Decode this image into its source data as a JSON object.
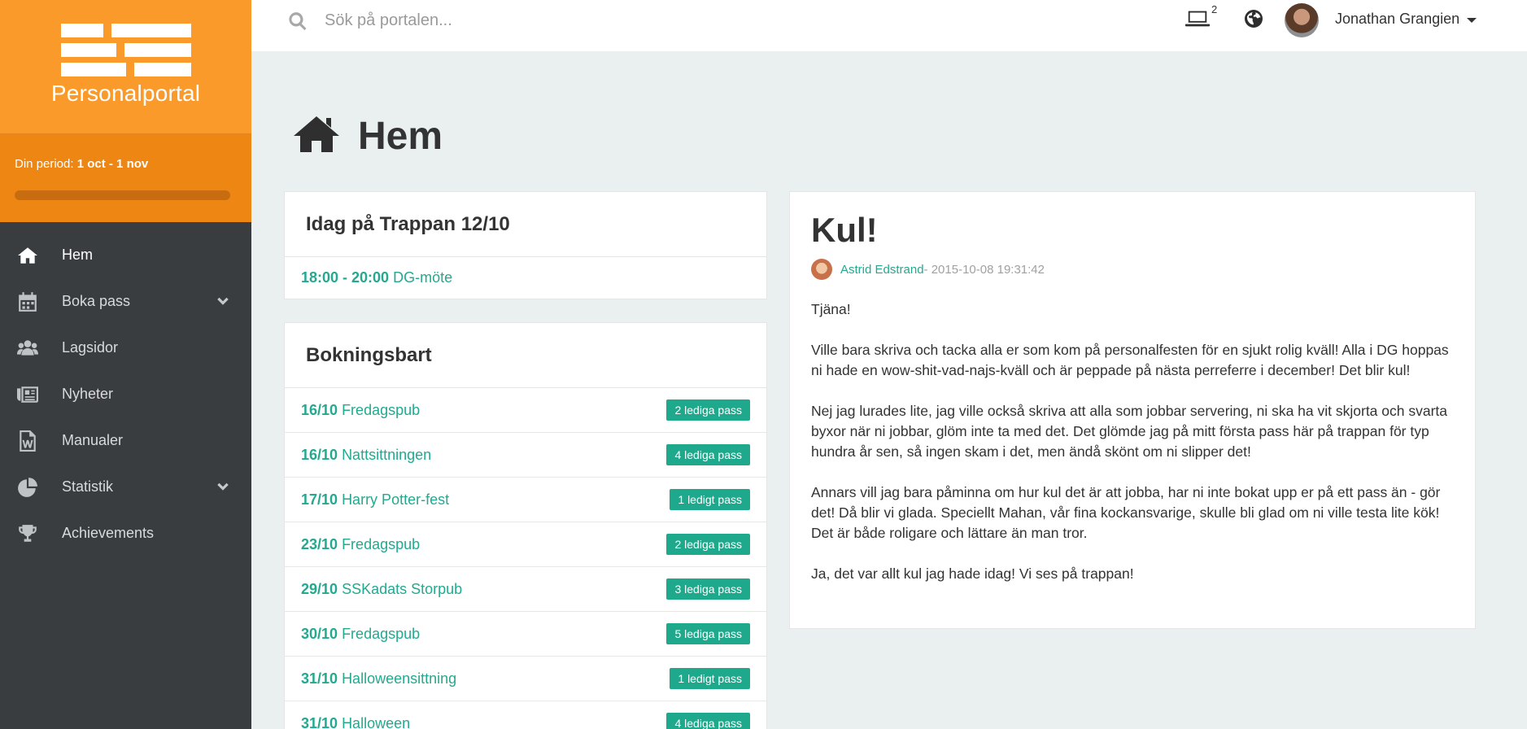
{
  "brand": {
    "name": "Personalportal"
  },
  "period": {
    "label": "Din period:",
    "value": "1 oct - 1 nov",
    "progress": 0.0
  },
  "nav": {
    "items": [
      {
        "label": "Hem",
        "icon": "home-icon",
        "active": true
      },
      {
        "label": "Boka pass",
        "icon": "calendar-icon",
        "expandable": true
      },
      {
        "label": "Lagsidor",
        "icon": "users-icon"
      },
      {
        "label": "Nyheter",
        "icon": "newspaper-icon"
      },
      {
        "label": "Manualer",
        "icon": "document-icon"
      },
      {
        "label": "Statistik",
        "icon": "pie-chart-icon",
        "expandable": true
      },
      {
        "label": "Achievements",
        "icon": "trophy-icon"
      }
    ]
  },
  "search": {
    "placeholder": "Sök på portalen..."
  },
  "topbar": {
    "device_count": "2",
    "user_name": "Jonathan Grangien"
  },
  "page": {
    "title": "Hem"
  },
  "today": {
    "title": "Idag på Trappan 12/10",
    "events": [
      {
        "time": "18:00 - 20:00",
        "name": "DG-möte"
      }
    ]
  },
  "booking": {
    "title": "Bokningsbart",
    "rows": [
      {
        "date": "16/10",
        "name": "Fredagspub",
        "badge": "2 lediga pass"
      },
      {
        "date": "16/10",
        "name": "Nattsittningen",
        "badge": "4 lediga pass"
      },
      {
        "date": "17/10",
        "name": "Harry Potter-fest",
        "badge": "1 ledigt pass"
      },
      {
        "date": "23/10",
        "name": "Fredagspub",
        "badge": "2 lediga pass"
      },
      {
        "date": "29/10",
        "name": "SSKadats Storpub",
        "badge": "3 lediga pass"
      },
      {
        "date": "30/10",
        "name": "Fredagspub",
        "badge": "5 lediga pass"
      },
      {
        "date": "31/10",
        "name": "Halloweensittning",
        "badge": "1 ledigt pass"
      },
      {
        "date": "31/10",
        "name": "Halloween",
        "badge": "4 lediga pass"
      }
    ]
  },
  "article": {
    "title": "Kul!",
    "author": "Astrid Edstrand",
    "date": " - 2015-10-08 19:31:42",
    "paragraphs": [
      "Tjäna!",
      "Ville bara skriva och tacka alla er som kom på personalfesten för en sjukt rolig kväll! Alla i DG hoppas ni hade en wow-shit-vad-najs-kväll och är peppade på nästa perreferre i december! Det blir kul!",
      "Nej jag lurades lite, jag ville också skriva att alla som jobbar servering, ni ska ha vit skjorta och svarta byxor när ni jobbar, glöm inte ta med det. Det glömde jag på mitt första pass här på trappan för typ hundra år sen, så ingen skam i det, men ändå skönt om ni slipper det!",
      "Annars vill jag bara påminna om hur kul det är att jobba, har ni inte bokat upp er på ett pass än - gör det! Då blir vi glada. Speciellt Mahan, vår fina kockansvarige, skulle bli glad om ni ville testa lite kök! Det är både roligare och lättare än man tror.",
      "Ja, det var allt kul jag hade idag! Vi ses på trappan!"
    ]
  },
  "colors": {
    "orange": "#f99a2b",
    "accent": "#1fa98c",
    "sidebar": "#393d40"
  }
}
